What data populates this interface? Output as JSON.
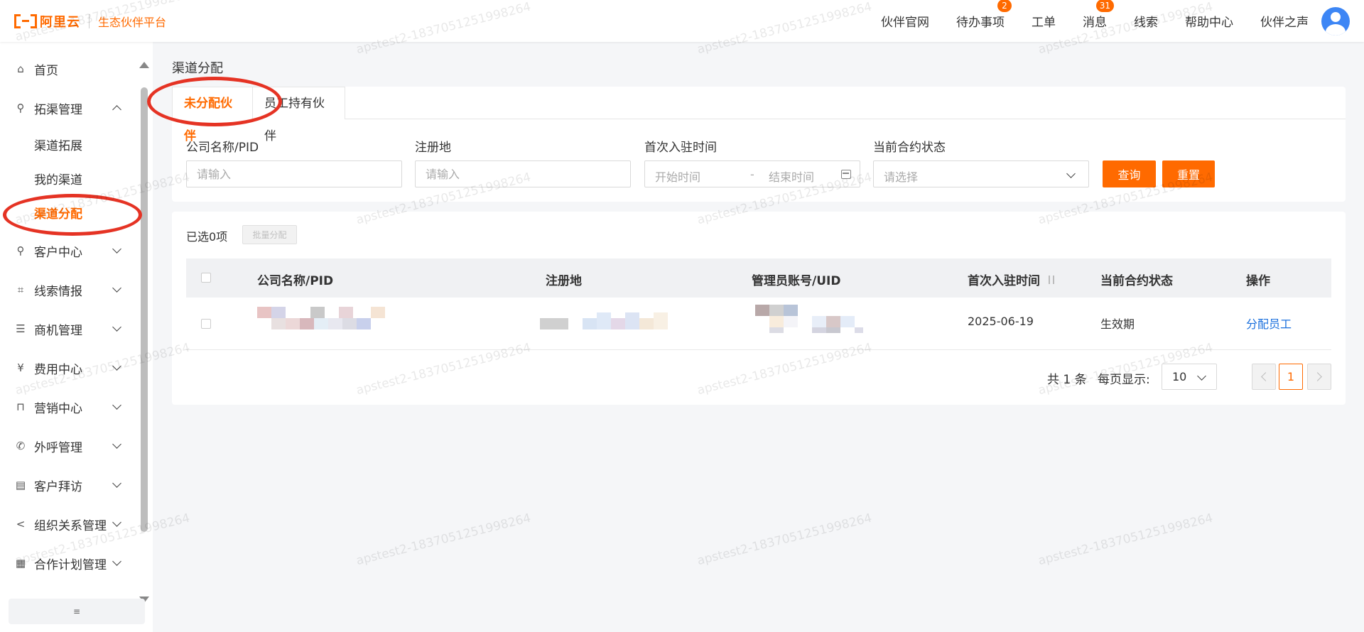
{
  "header": {
    "logo_text": "阿里云",
    "logo_sub": "生态伙伴平台",
    "nav": [
      {
        "label": "伙伴官网"
      },
      {
        "label": "待办事项",
        "badge": "2"
      },
      {
        "label": "工单"
      },
      {
        "label": "消息",
        "badge": "31"
      },
      {
        "label": "线索"
      },
      {
        "label": "帮助中心"
      },
      {
        "label": "伙伴之声"
      }
    ]
  },
  "sidebar": {
    "items": [
      {
        "label": "首页",
        "icon": "home-icon"
      },
      {
        "label": "拓渠管理",
        "icon": "user-search-icon",
        "expanded": true
      },
      {
        "label": "渠道拓展"
      },
      {
        "label": "我的渠道"
      },
      {
        "label": "渠道分配",
        "active": true
      },
      {
        "label": "客户中心",
        "icon": "user-search-icon"
      },
      {
        "label": "线索情报",
        "icon": "network-icon"
      },
      {
        "label": "商机管理",
        "icon": "list-icon"
      },
      {
        "label": "费用中心",
        "icon": "yen-calendar-icon"
      },
      {
        "label": "营销中心",
        "icon": "bag-icon"
      },
      {
        "label": "外呼管理",
        "icon": "phone-icon"
      },
      {
        "label": "客户拜访",
        "icon": "calendar-icon"
      },
      {
        "label": "组织关系管理",
        "icon": "share-icon"
      },
      {
        "label": "合作计划管理",
        "icon": "plan-calendar-icon"
      }
    ]
  },
  "main": {
    "page_title": "渠道分配",
    "tabs": [
      {
        "label": "未分配伙伴",
        "active": true
      },
      {
        "label": "员工持有伙伴"
      }
    ],
    "filters": {
      "company_label": "公司名称/PID",
      "company_placeholder": "请输入",
      "region_label": "注册地",
      "region_placeholder": "请输入",
      "date_label": "首次入驻时间",
      "date_start_placeholder": "开始时间",
      "date_sep": "-",
      "date_end_placeholder": "结束时间",
      "status_label": "当前合约状态",
      "status_placeholder": "请选择",
      "query_button": "查询",
      "reset_button": "重置"
    },
    "table": {
      "selected_count": "已选0项",
      "batch_button": "批量分配",
      "columns": [
        "公司名称/PID",
        "注册地",
        "管理员账号/UID",
        "首次入驻时间",
        "当前合约状态",
        "操作"
      ],
      "rows": [
        {
          "join_date": "2025-06-19",
          "status": "生效期",
          "action": "分配员工"
        }
      ]
    },
    "pagination": {
      "total": "共 1 条",
      "per_page_label": "每页显示:",
      "per_page_value": "10",
      "current_page": "1"
    }
  },
  "watermark": "apstest2-1837051251998264",
  "colors": {
    "accent": "#ff6a00",
    "link": "#1a6fdd",
    "annotation": "#e53324"
  }
}
